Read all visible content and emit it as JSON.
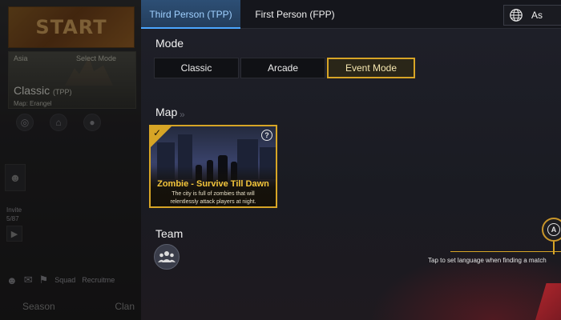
{
  "lobby": {
    "start_label": "START",
    "region": "Asia",
    "select_mode": "Select Mode",
    "mode_name": "Classic",
    "mode_view": "(TPP)",
    "map_name": "Map: Erangel",
    "invite_label": "Invite",
    "invite_count": "5/87",
    "squad_label": "Squad",
    "recruit_label": "Recruitme",
    "season_label": "Season",
    "clan_label": "Clan"
  },
  "tabs": [
    {
      "label": "Third Person (TPP)",
      "active": true
    },
    {
      "label": "First Person (FPP)",
      "active": false
    }
  ],
  "language": {
    "code": "As"
  },
  "mode_section": {
    "title": "Mode",
    "options": [
      {
        "label": "Classic",
        "selected": false
      },
      {
        "label": "Arcade",
        "selected": false
      },
      {
        "label": "Event Mode",
        "selected": true
      }
    ]
  },
  "map_section": {
    "title": "Map",
    "card": {
      "name": "Zombie - Survive Till Dawn",
      "description": "The city is full of zombies that will relentlessly attack players at night.",
      "selected": true
    }
  },
  "team_section": {
    "title": "Team"
  },
  "tip": {
    "text": "Tap to set language when finding a match"
  },
  "colors": {
    "accent_gold": "#d7a526",
    "tab_active": "#2d4f75",
    "tab_active_text": "#9fd0ff"
  }
}
